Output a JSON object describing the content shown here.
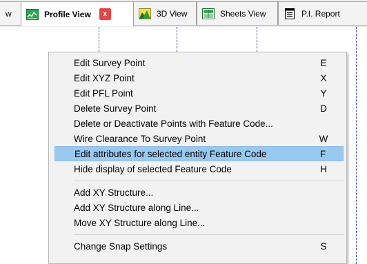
{
  "tabs": {
    "cut_tab_label": "w",
    "profile_view": {
      "label": "Profile View",
      "close_label": "x"
    },
    "view_3d": {
      "label": "3D View"
    },
    "sheets_view": {
      "label": "Sheets View"
    },
    "pi_report": {
      "label": "P.I. Report"
    }
  },
  "icons": {
    "profile_view": "profile-chart-icon",
    "view_3d": "3d-terrain-icon",
    "sheets_view": "sheets-icon",
    "pi_report": "report-document-icon"
  },
  "colors": {
    "highlight": "#99c9ef",
    "close_button": "#e64545",
    "guide_lines": "#3b4cb0",
    "icon_green": "#1f8a3a"
  },
  "context_menu": {
    "groups": [
      [
        {
          "label": "Edit Survey Point",
          "key": "E"
        },
        {
          "label": "Edit XYZ Point",
          "key": "X"
        },
        {
          "label": "Edit PFL Point",
          "key": "Y"
        },
        {
          "label": "Delete Survey Point",
          "key": "D"
        },
        {
          "label": "Delete or Deactivate Points with Feature Code...",
          "key": ""
        },
        {
          "label": "Wire Clearance To Survey Point",
          "key": "W"
        },
        {
          "label": "Edit attributes for selected entity Feature Code",
          "key": "F",
          "highlighted": true
        },
        {
          "label": "Hide display of selected Feature Code",
          "key": "H"
        }
      ],
      [
        {
          "label": "Add XY Structure...",
          "key": ""
        },
        {
          "label": "Add XY Structure along Line...",
          "key": ""
        },
        {
          "label": "Move XY Structure along Line...",
          "key": ""
        }
      ],
      [
        {
          "label": "Change Snap Settings",
          "key": "S"
        }
      ]
    ]
  }
}
